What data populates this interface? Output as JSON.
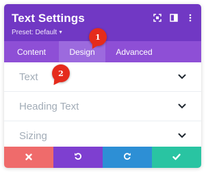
{
  "header": {
    "title": "Text Settings",
    "preset": "Preset: Default",
    "icons": [
      "expand-icon",
      "sidebar-layout-icon",
      "more-vertical-icon"
    ]
  },
  "tabs": [
    {
      "label": "Content",
      "active": false
    },
    {
      "label": "Design",
      "active": true
    },
    {
      "label": "Advanced",
      "active": false
    }
  ],
  "sections": [
    {
      "label": "Text"
    },
    {
      "label": "Heading Text"
    },
    {
      "label": "Sizing"
    }
  ],
  "footer": {
    "buttons": [
      {
        "name": "discard-button",
        "icon": "close-icon",
        "color": "#ef6b6b"
      },
      {
        "name": "undo-button",
        "icon": "undo-icon",
        "color": "#7e3fd0"
      },
      {
        "name": "redo-button",
        "icon": "redo-icon",
        "color": "#2d8fd5"
      },
      {
        "name": "save-button",
        "icon": "check-icon",
        "color": "#29c4a2"
      }
    ]
  },
  "annotations": [
    {
      "number": "1"
    },
    {
      "number": "2"
    }
  ],
  "colors": {
    "header": "#7138c4",
    "tabs": "#8e4fd6",
    "active_tab": "#9c6ade",
    "section_text": "#a2acb7",
    "badge": "#e52b1c"
  }
}
